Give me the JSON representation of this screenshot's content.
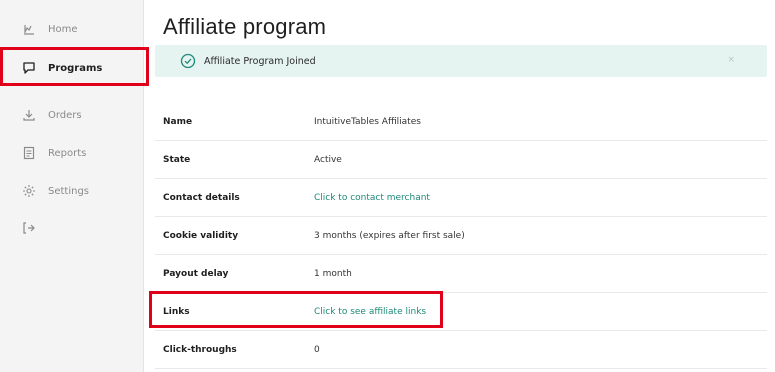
{
  "sidebar": {
    "items": [
      {
        "label": "Home",
        "icon": "chart-icon"
      },
      {
        "label": "Programs",
        "icon": "chat-icon",
        "active": true
      },
      {
        "label": "Orders",
        "icon": "download-icon"
      },
      {
        "label": "Reports",
        "icon": "document-icon"
      },
      {
        "label": "Settings",
        "icon": "gear-icon"
      },
      {
        "label": "",
        "icon": "logout-icon"
      }
    ]
  },
  "page": {
    "title": "Affiliate program"
  },
  "alert": {
    "message": "Affiliate Program Joined",
    "close": "×"
  },
  "details": [
    {
      "label": "Name",
      "value": "IntuitiveTables Affiliates",
      "link": false
    },
    {
      "label": "State",
      "value": "Active",
      "link": false
    },
    {
      "label": "Contact details",
      "value": "Click to contact merchant",
      "link": true
    },
    {
      "label": "Cookie validity",
      "value": "3 months (expires after first sale)",
      "link": false
    },
    {
      "label": "Payout delay",
      "value": "1 month",
      "link": false
    },
    {
      "label": "Links",
      "value": "Click to see affiliate links",
      "link": true
    },
    {
      "label": "Click-throughs",
      "value": "0",
      "link": false
    }
  ],
  "colors": {
    "accent": "#1c8a78",
    "highlight": "#e1001a",
    "alert_bg": "#e5f3f1"
  }
}
